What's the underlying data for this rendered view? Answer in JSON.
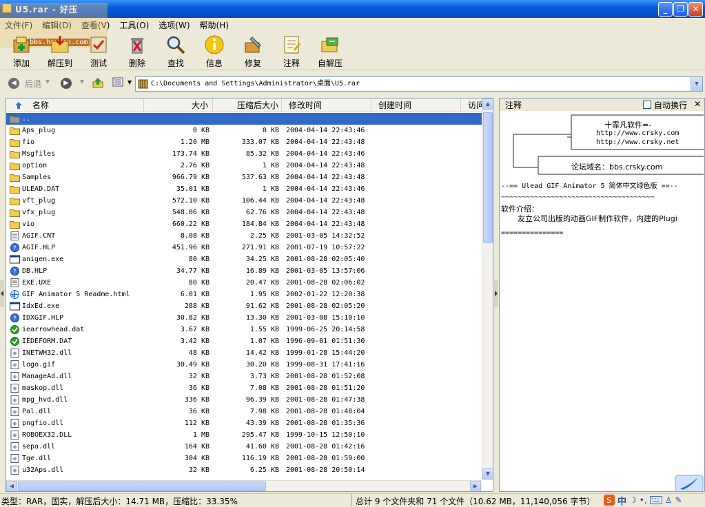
{
  "window": {
    "title": "U5.rar - 好压",
    "minimize": "_",
    "maximize": "❐",
    "close": "✕"
  },
  "watermark": {
    "url": "bbs.houdao.com"
  },
  "menu": [
    "文件(F)",
    "编辑(D)",
    "查看(V)",
    "工具(O)",
    "选项(W)",
    "帮助(H)"
  ],
  "toolbar": [
    {
      "label": "添加",
      "icon": "add-archive-icon"
    },
    {
      "label": "解压到",
      "icon": "extract-to-icon"
    },
    {
      "label": "测试",
      "icon": "test-icon"
    },
    {
      "label": "删除",
      "icon": "delete-icon"
    },
    {
      "label": "查找",
      "icon": "find-icon"
    },
    {
      "label": "信息",
      "icon": "info-icon"
    },
    {
      "label": "修复",
      "icon": "repair-icon"
    },
    {
      "label": "注释",
      "icon": "comment-icon"
    },
    {
      "label": "自解压",
      "icon": "sfx-icon"
    }
  ],
  "nav": {
    "back_label": "后退",
    "path": "C:\\Documents and Settings\\Administrator\\桌面\\U5.rar"
  },
  "columns": {
    "name": "名称",
    "size": "大小",
    "packed": "压缩后大小",
    "modified": "修改时间",
    "created": "创建时间",
    "accessed": "访问"
  },
  "files": [
    {
      "name": "..",
      "size": "",
      "packed": "",
      "modified": "",
      "type": "up"
    },
    {
      "name": "Aps_plug",
      "size": "0 KB",
      "packed": "0 KB",
      "modified": "2004-04-14 22:43:46",
      "type": "folder"
    },
    {
      "name": "fio",
      "size": "1.20 MB",
      "packed": "333.07 KB",
      "modified": "2004-04-14 22:43:48",
      "type": "folder"
    },
    {
      "name": "Msgfiles",
      "size": "173.74 KB",
      "packed": "85.32 KB",
      "modified": "2004-04-14 22:43:46",
      "type": "folder"
    },
    {
      "name": "option",
      "size": "2.76 KB",
      "packed": "1 KB",
      "modified": "2004-04-14 22:43:48",
      "type": "folder"
    },
    {
      "name": "Samples",
      "size": "966.79 KB",
      "packed": "537.63 KB",
      "modified": "2004-04-14 22:43:48",
      "type": "folder"
    },
    {
      "name": "ULEAD.DAT",
      "size": "35.01 KB",
      "packed": "1 KB",
      "modified": "2004-04-14 22:43:46",
      "type": "folder"
    },
    {
      "name": "vft_plug",
      "size": "572.10 KB",
      "packed": "106.44 KB",
      "modified": "2004-04-14 22:43:48",
      "type": "folder"
    },
    {
      "name": "vfx_plug",
      "size": "548.06 KB",
      "packed": "62.76 KB",
      "modified": "2004-04-14 22:43:48",
      "type": "folder"
    },
    {
      "name": "vio",
      "size": "660.22 KB",
      "packed": "184.84 KB",
      "modified": "2004-04-14 22:43:48",
      "type": "folder"
    },
    {
      "name": "AGIF.CNT",
      "size": "8.08 KB",
      "packed": "2.25 KB",
      "modified": "2001-03-05 14:32:52",
      "type": "doc"
    },
    {
      "name": "AGIF.HLP",
      "size": "451.96 KB",
      "packed": "271.91 KB",
      "modified": "2001-07-19 10:57:22",
      "type": "help"
    },
    {
      "name": "anigen.exe",
      "size": "80 KB",
      "packed": "34.25 KB",
      "modified": "2001-08-28 02:05:40",
      "type": "exe"
    },
    {
      "name": "DB.HLP",
      "size": "34.77 KB",
      "packed": "16.89 KB",
      "modified": "2001-03-05 13:57:06",
      "type": "help"
    },
    {
      "name": "EXE.UXE",
      "size": "80 KB",
      "packed": "20.47 KB",
      "modified": "2001-08-28 02:06:02",
      "type": "doc"
    },
    {
      "name": "GIF Animator 5 Readme.html",
      "size": "6.01 KB",
      "packed": "1.95 KB",
      "modified": "2002-01-22 12:20:38",
      "type": "html"
    },
    {
      "name": "IdxEd.exe",
      "size": "288 KB",
      "packed": "91.62 KB",
      "modified": "2001-08-28 02:05:20",
      "type": "exe"
    },
    {
      "name": "IDXGIF.HLP",
      "size": "30.82 KB",
      "packed": "13.30 KB",
      "modified": "2001-03-08 15:10:10",
      "type": "help"
    },
    {
      "name": "iearrowhead.dat",
      "size": "3.67 KB",
      "packed": "1.55 KB",
      "modified": "1999-06-25 20:14:58",
      "type": "dat"
    },
    {
      "name": "IEDEFORM.DAT",
      "size": "3.42 KB",
      "packed": "1.07 KB",
      "modified": "1996-09-01 01:51:30",
      "type": "dat"
    },
    {
      "name": "INETWH32.dll",
      "size": "48 KB",
      "packed": "14.42 KB",
      "modified": "1999-01-28 15:44:20",
      "type": "dll"
    },
    {
      "name": "logo.gif",
      "size": "30.49 KB",
      "packed": "30.20 KB",
      "modified": "1999-08-31 17:41:16",
      "type": "dll"
    },
    {
      "name": "ManageAd.dll",
      "size": "32 KB",
      "packed": "3.73 KB",
      "modified": "2001-08-28 01:52:08",
      "type": "dll"
    },
    {
      "name": "maskop.dll",
      "size": "36 KB",
      "packed": "7.08 KB",
      "modified": "2001-08-28 01:51:20",
      "type": "dll"
    },
    {
      "name": "mpg_hvd.dll",
      "size": "336 KB",
      "packed": "96.39 KB",
      "modified": "2001-08-28 01:47:38",
      "type": "dll"
    },
    {
      "name": "Pal.dll",
      "size": "36 KB",
      "packed": "7.98 KB",
      "modified": "2001-08-28 01:48:04",
      "type": "dll"
    },
    {
      "name": "pngfio.dll",
      "size": "112 KB",
      "packed": "43.39 KB",
      "modified": "2001-08-28 01:35:36",
      "type": "dll"
    },
    {
      "name": "ROBOEX32.DLL",
      "size": "1 MB",
      "packed": "295.47 KB",
      "modified": "1999-10-15 12:50:10",
      "type": "dll"
    },
    {
      "name": "sepa.dll",
      "size": "164 KB",
      "packed": "41.60 KB",
      "modified": "2001-08-28 01:42:16",
      "type": "dll"
    },
    {
      "name": "Tge.dll",
      "size": "304 KB",
      "packed": "116.19 KB",
      "modified": "2001-08-28 01:59:00",
      "type": "dll"
    },
    {
      "name": "u32Aps.dll",
      "size": "32 KB",
      "packed": "6.25 KB",
      "modified": "2001-08-28 20:50:14",
      "type": "dll"
    }
  ],
  "comment": {
    "title": "注释",
    "autowrap": "自动换行",
    "close": "✕",
    "box1_line1": "十霏凡软件=-",
    "box1_line2": "http://www.crsky.com",
    "box1_line3": "http://www.crsky.net",
    "box2": "论坛域名：bbs.crsky.com",
    "banner": "--== Ulead GIF Animator 5 简体中文绿色版 ==--",
    "wave": "~~~~~~~~~~~~~~~~~~~~~~~~~~~~~~~~~~~~~",
    "intro_title": "软件介绍：",
    "intro_text": "友立公司出版的动画GIF制作软件，内建的Plugi",
    "rule": "==============="
  },
  "status": {
    "left": "类型：RAR，固实，解压后大小：14.71 MB，压缩比：33.35%",
    "right": "总计 9 个文件夹和 71 个文件（10.62 MB，11,140,056 字节）"
  },
  "tray": {
    "ime": "中"
  },
  "colors": {
    "selection": "#316ac5",
    "titlebar": "#0a5ddc",
    "folder": "#f2cd55"
  }
}
